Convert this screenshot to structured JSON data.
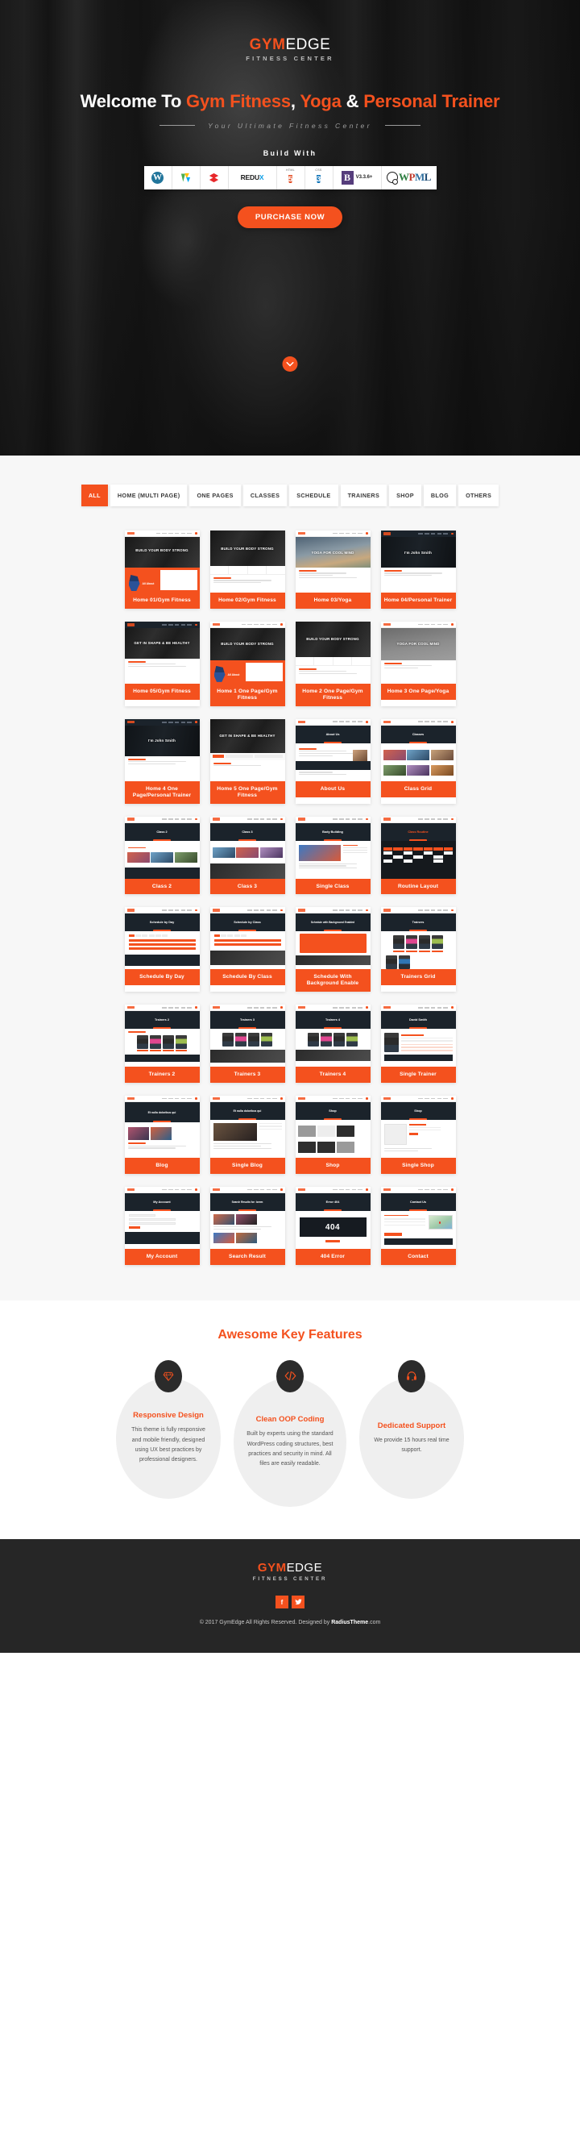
{
  "hero": {
    "logo": {
      "gym": "GYM",
      "edge": "EDGE",
      "tagline": "FITNESS CENTER"
    },
    "title_parts": {
      "p1": "Welcome To ",
      "p2": "Gym Fitness",
      "p3": ", ",
      "p4": "Yoga",
      "p5": " & ",
      "p6": "Personal Trainer"
    },
    "subtitle": "Your Ultimate Fitness Center",
    "build_with_label": "Build With",
    "tech_logos": [
      {
        "name": "wordpress-logo",
        "text": "W"
      },
      {
        "name": "visual-composer-logo",
        "text": ""
      },
      {
        "name": "redux-framework-logo",
        "text": ""
      },
      {
        "name": "redux-logo",
        "text": "REDU",
        "accent": "X"
      },
      {
        "name": "html5-logo",
        "top": "HTML",
        "text": "5"
      },
      {
        "name": "css3-logo",
        "top": "CSS",
        "text": "3"
      },
      {
        "name": "bootstrap-logo",
        "text": "B",
        "version": "V3.3.6+"
      },
      {
        "name": "wpml-logo",
        "w": "W",
        "p": "P",
        "m": "M",
        "l": "L"
      }
    ],
    "purchase_button": "PURCHASE NOW",
    "scroll_icon": "chevron-down-icon"
  },
  "filters": [
    {
      "label": "ALL",
      "active": true
    },
    {
      "label": "HOME (MULTI PAGE)",
      "active": false
    },
    {
      "label": "ONE PAGES",
      "active": false
    },
    {
      "label": "CLASSES",
      "active": false
    },
    {
      "label": "SCHEDULE",
      "active": false
    },
    {
      "label": "TRAINERS",
      "active": false
    },
    {
      "label": "SHOP",
      "active": false
    },
    {
      "label": "BLOG",
      "active": false
    },
    {
      "label": "OTHERS",
      "active": false
    }
  ],
  "demos": [
    {
      "label": "Home 01/Gym Fitness",
      "hero": "BUILD YOUR BODY STRONG"
    },
    {
      "label": "Home 02/Gym Fitness",
      "hero": "BUILD YOUR BODY STRONG"
    },
    {
      "label": "Home 03/Yoga",
      "hero": "YOGA FOR COOL MIND"
    },
    {
      "label": "Home 04/Personal Trainer",
      "hero": "I'm John Smith"
    },
    {
      "label": "Home 05/Gym Fitness",
      "hero": "GET IN SHAPE & BE HEALTHY"
    },
    {
      "label": "Home 1 One Page/Gym Fitness",
      "hero": "BUILD YOUR BODY STRONG"
    },
    {
      "label": "Home 2 One Page/Gym Fitness",
      "hero": "BUILD YOUR BODY STRONG"
    },
    {
      "label": "Home 3 One Page/Yoga",
      "hero": "YOGA FOR COOL MIND"
    },
    {
      "label": "Home 4 One Page/Personal Trainer",
      "hero": "I'm John Smith"
    },
    {
      "label": "Home 5 One Page/Gym Fitness",
      "hero": "GET IN SHAPE & BE HEALTHY"
    },
    {
      "label": "About Us",
      "hero": "About Us"
    },
    {
      "label": "Class Grid",
      "hero": "Classes"
    },
    {
      "label": "Class 2",
      "hero": "Class 2"
    },
    {
      "label": "Class 3",
      "hero": "Class 3"
    },
    {
      "label": "Single Class",
      "hero": "Body Building"
    },
    {
      "label": "Routine Layout",
      "hero": "Class Routine"
    },
    {
      "label": "Schedule By Day",
      "hero": "Schedule by Day"
    },
    {
      "label": "Schedule By Class",
      "hero": "Schedule by Class"
    },
    {
      "label": "Schedule With Background Enable",
      "hero": "Schedule with Background Enabled"
    },
    {
      "label": "Trainers Grid",
      "hero": "Trainers"
    },
    {
      "label": "Trainers 2",
      "hero": "Trainers 2"
    },
    {
      "label": "Trainers 3",
      "hero": "Trainers 3"
    },
    {
      "label": "Trainers 4",
      "hero": "Trainers 4"
    },
    {
      "label": "Single Trainer",
      "hero": "David Smith"
    },
    {
      "label": "Blog",
      "hero": "Et nulla doloribus qui"
    },
    {
      "label": "Single Blog",
      "hero": "Et nulla doloribus qui"
    },
    {
      "label": "Shop",
      "hero": "Shop"
    },
    {
      "label": "Single Shop",
      "hero": "Shop"
    },
    {
      "label": "My Account",
      "hero": "My Account"
    },
    {
      "label": "Search Result",
      "hero": "Search Results for: lorem"
    },
    {
      "label": "404 Error",
      "hero": "Error 404",
      "big": "404"
    },
    {
      "label": "Contact",
      "hero": "Contact Us"
    }
  ],
  "features": {
    "title": "Awesome Key Features",
    "items": [
      {
        "icon": "diamond-icon",
        "name": "Responsive Design",
        "desc": "This theme is fully responsive and mobile friendly, designed using UX best practices by professional designers."
      },
      {
        "icon": "code-icon",
        "name": "Clean OOP Coding",
        "desc": "Built by experts using the standard WordPress coding structures, best practices and security in mind. All files are easily readable."
      },
      {
        "icon": "support-headset-icon",
        "name": "Dedicated Support",
        "desc": "We provide 15 hours real time support."
      }
    ]
  },
  "footer": {
    "logo": {
      "gym": "GYM",
      "edge": "EDGE",
      "tagline": "FITNESS CENTER"
    },
    "socials": [
      {
        "name": "facebook-icon",
        "glyph": "f"
      },
      {
        "name": "twitter-icon",
        "glyph": "✐"
      }
    ],
    "copyright_pre": "© 2017 GymEdge All Rights Reserved.   Designed by ",
    "copyright_brand": "RadiusTheme",
    "copyright_post": ".com"
  },
  "colors": {
    "accent": "#f4511e",
    "dark": "#262626",
    "panel_bg": "#f7f7f7",
    "navy": "#1b232b"
  }
}
